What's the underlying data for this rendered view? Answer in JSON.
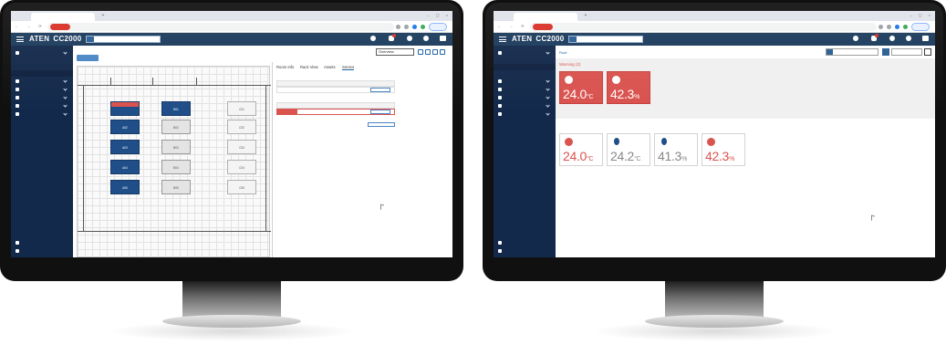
{
  "colors": {
    "header": "#1b3a5c",
    "sidebar": "#13294b",
    "accent": "#1b5e9e",
    "alert": "#d9534f",
    "rack_active": "#1f4e89"
  },
  "icons": {
    "menu": "hamburger-icon",
    "search": "search-icon",
    "chat": "chat-icon",
    "notification": "bell-icon",
    "user": "user-icon",
    "help": "help-icon",
    "temperature": "thermometer-icon",
    "humidity": "droplet-icon",
    "favorites": "star-icon",
    "recent": "history-icon"
  },
  "app": {
    "brand": "ATEN",
    "product": "CC2000"
  },
  "browser": {
    "tab_title": "",
    "url": ""
  },
  "sidebar": {
    "items": [
      {
        "label": ""
      },
      {
        "label": ""
      },
      {
        "label": ""
      },
      {
        "label": ""
      },
      {
        "label": ""
      },
      {
        "label": ""
      },
      {
        "label": ""
      },
      {
        "label": ""
      },
      {
        "label": ""
      },
      {
        "label": ""
      },
      {
        "label": ""
      }
    ],
    "bottom": [
      {
        "label": ""
      },
      {
        "label": ""
      }
    ]
  },
  "floor_view": {
    "breadcrumb": "",
    "mode_select": "Overview",
    "panel_tabs": [
      "Room Info",
      "Rack View",
      "Assets",
      "Sensor"
    ],
    "sensor_groups": {
      "temperature": "",
      "humidity": ""
    },
    "buttons": {
      "show_history": "",
      "show_all_history": ""
    },
    "racks": {
      "a": [
        "",
        "A02",
        "A03",
        "A04",
        "A05"
      ],
      "b": [
        "B01",
        "B02",
        "B03",
        "B04",
        "B05"
      ],
      "c": [
        "C01",
        "C02",
        "C03",
        "C04",
        "C05"
      ]
    },
    "alert_rack": {
      "humidity": "",
      "temperature": ""
    }
  },
  "dashboard": {
    "root_label": "Root",
    "warning_title": "Warning (2)",
    "normal_title": "",
    "tool_button": "",
    "warning_cards": [
      {
        "value": "24.0",
        "unit": "°C"
      },
      {
        "value": "42.3",
        "unit": "%"
      }
    ],
    "normal_cards": [
      {
        "value": "24.0",
        "unit": "°C"
      },
      {
        "value": "24.2",
        "unit": "°C"
      },
      {
        "value": "41.3",
        "unit": "%"
      },
      {
        "value": "42.3",
        "unit": "%"
      }
    ]
  }
}
